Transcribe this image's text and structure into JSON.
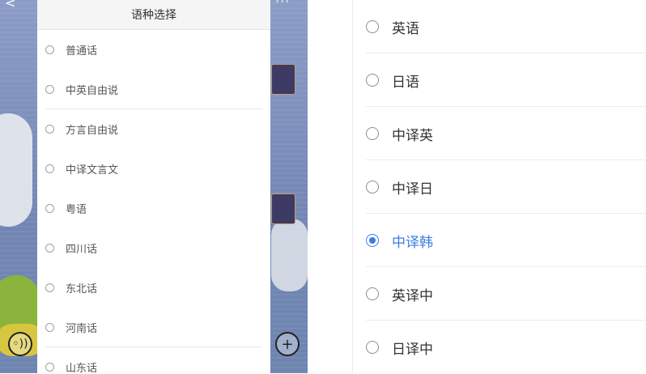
{
  "left": {
    "sheet_title": "语种选择",
    "items": [
      "普通话",
      "中英自由说",
      "方言自由说",
      "中译文言文",
      "粤语",
      "四川话",
      "东北话",
      "河南话",
      "山东话"
    ],
    "top_left_icon": "back-chevron-icon",
    "top_right_icon": "more-icon",
    "bottom_left_icon": "voice-icon",
    "bottom_right_icon": "add-icon"
  },
  "right": {
    "items": [
      {
        "label": "英语",
        "checked": false
      },
      {
        "label": "日语",
        "checked": false
      },
      {
        "label": "中译英",
        "checked": false
      },
      {
        "label": "中译日",
        "checked": false
      },
      {
        "label": "中译韩",
        "checked": true
      },
      {
        "label": "英译中",
        "checked": false
      },
      {
        "label": "日译中",
        "checked": false
      }
    ]
  },
  "colors": {
    "accent": "#3b7de6",
    "sheet_header_bg": "#f5f5f5",
    "bg_blue": "#7b8db9"
  }
}
